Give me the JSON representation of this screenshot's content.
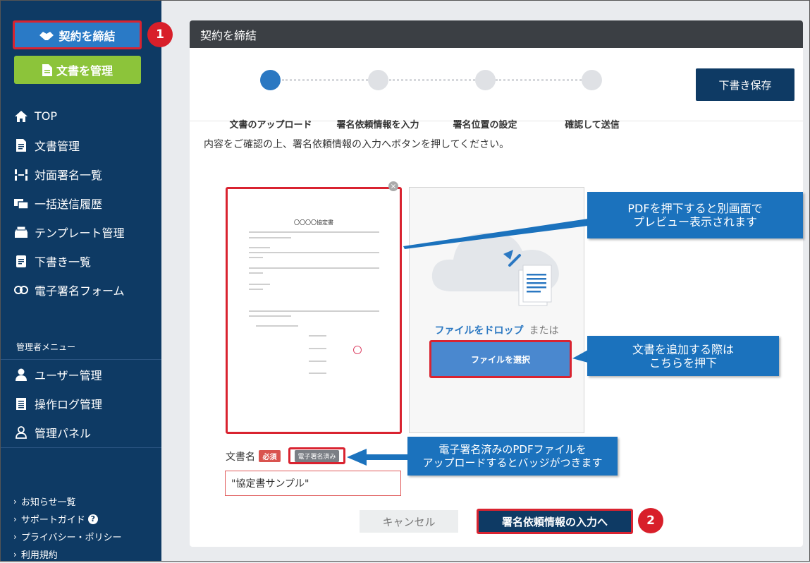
{
  "sidebar": {
    "contract_button": "契約を締結",
    "docs_button": "文書を管理",
    "nav": [
      {
        "label": "TOP",
        "icon": "home-icon"
      },
      {
        "label": "文書管理",
        "icon": "document-icon"
      },
      {
        "label": "対面署名一覧",
        "icon": "face-sign-icon"
      },
      {
        "label": "一括送信履歴",
        "icon": "batch-send-icon"
      },
      {
        "label": "テンプレート管理",
        "icon": "template-icon"
      },
      {
        "label": "下書き一覧",
        "icon": "draft-icon"
      },
      {
        "label": "電子署名フォーム",
        "icon": "link-icon"
      }
    ],
    "admin_menu_label": "管理者メニュー",
    "admin_nav": [
      {
        "label": "ユーザー管理",
        "icon": "user-icon"
      },
      {
        "label": "操作ログ管理",
        "icon": "log-icon"
      },
      {
        "label": "管理パネル",
        "icon": "admin-panel-icon"
      }
    ],
    "footer_links": [
      "お知らせ一覧",
      "サポートガイド",
      "プライバシー・ポリシー",
      "利用規約"
    ]
  },
  "annotations": {
    "badge1": "1",
    "badge2": "2",
    "callout_preview": "PDFを押下すると別画面で\nプレビュー表示されます",
    "callout_add": "文書を追加する際は\nこちらを押下",
    "callout_badge": "電子署名済みのPDFファイルを\nアップロードするとバッジがつきます"
  },
  "panel": {
    "title": "契約を締結",
    "steps": [
      "文書のアップロード",
      "署名依頼情報を入力",
      "署名位置の設定",
      "確認して送信"
    ],
    "active_step": 0,
    "save_draft": "下書き保存",
    "instruction": "内容をご確認の上、署名依頼情報の入力へボタンを押してください。",
    "preview_doc_title": "〇〇〇〇協定書",
    "dropzone_drop": "ファイルをドロップ",
    "dropzone_or": "または",
    "select_file": "ファイルを選択",
    "field_label": "文書名",
    "required_badge": "必須",
    "signed_badge": "電子署名済み",
    "doc_name_value": "\"協定書サンプル\"",
    "cancel": "キャンセル",
    "next": "署名依頼情報の入力へ"
  },
  "colors": {
    "sidebar_bg": "#0e3a64",
    "accent_blue": "#2b78c2",
    "docs_green": "#8cc43a",
    "highlight_red": "#d92330",
    "callout_blue": "#1b72bd"
  }
}
